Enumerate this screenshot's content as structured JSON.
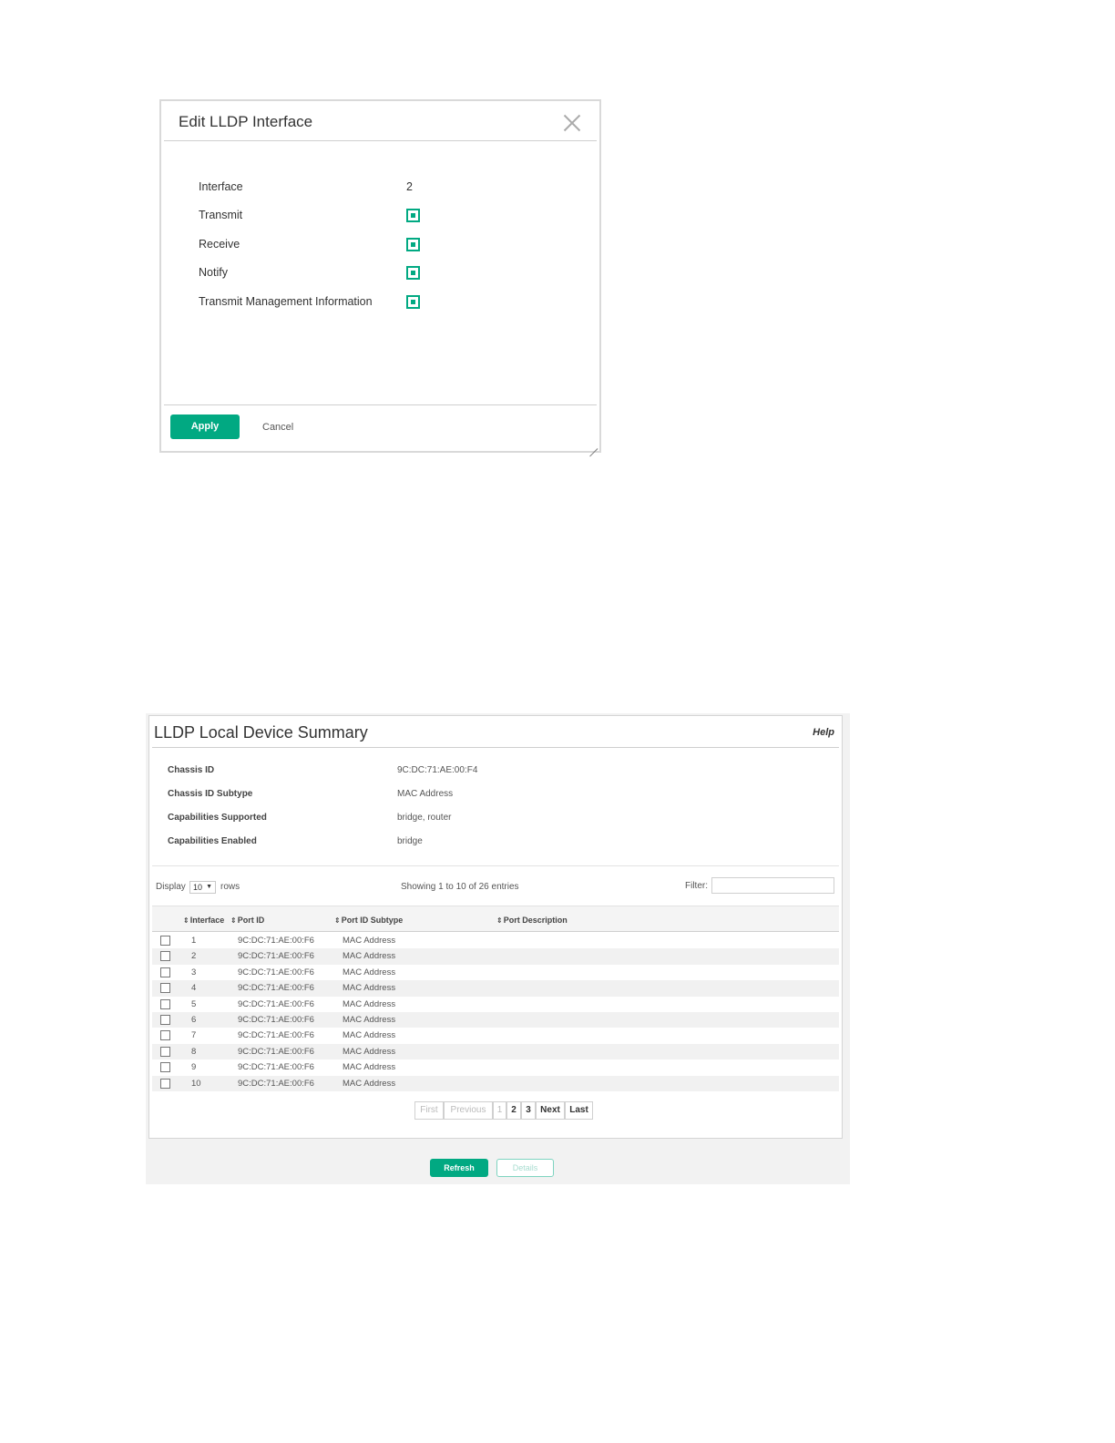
{
  "dialog": {
    "title": "Edit LLDP Interface",
    "fields": [
      {
        "label": "Interface",
        "value": "2"
      },
      {
        "label": "Transmit",
        "checked": true
      },
      {
        "label": "Receive",
        "checked": true
      },
      {
        "label": "Notify",
        "checked": true
      },
      {
        "label": "Transmit Management Information",
        "checked": true
      }
    ],
    "apply_label": "Apply",
    "cancel_label": "Cancel"
  },
  "summary": {
    "title": "LLDP Local Device Summary",
    "help_label": "Help",
    "info": [
      {
        "label": "Chassis ID",
        "value": "9C:DC:71:AE:00:F4"
      },
      {
        "label": "Chassis ID Subtype",
        "value": "MAC Address"
      },
      {
        "label": "Capabilities Supported",
        "value": "bridge, router"
      },
      {
        "label": "Capabilities Enabled",
        "value": "bridge"
      }
    ],
    "display_label": "Display",
    "display_value": "10",
    "rows_label": "rows",
    "showing_text": "Showing 1 to 10 of 26 entries",
    "filter_label": "Filter:",
    "filter_value": "",
    "columns": [
      "Interface",
      "Port ID",
      "Port ID Subtype",
      "Port Description"
    ],
    "rows": [
      {
        "interface": "1",
        "port_id": "9C:DC:71:AE:00:F6",
        "subtype": "MAC Address",
        "description": ""
      },
      {
        "interface": "2",
        "port_id": "9C:DC:71:AE:00:F6",
        "subtype": "MAC Address",
        "description": ""
      },
      {
        "interface": "3",
        "port_id": "9C:DC:71:AE:00:F6",
        "subtype": "MAC Address",
        "description": ""
      },
      {
        "interface": "4",
        "port_id": "9C:DC:71:AE:00:F6",
        "subtype": "MAC Address",
        "description": ""
      },
      {
        "interface": "5",
        "port_id": "9C:DC:71:AE:00:F6",
        "subtype": "MAC Address",
        "description": ""
      },
      {
        "interface": "6",
        "port_id": "9C:DC:71:AE:00:F6",
        "subtype": "MAC Address",
        "description": ""
      },
      {
        "interface": "7",
        "port_id": "9C:DC:71:AE:00:F6",
        "subtype": "MAC Address",
        "description": ""
      },
      {
        "interface": "8",
        "port_id": "9C:DC:71:AE:00:F6",
        "subtype": "MAC Address",
        "description": ""
      },
      {
        "interface": "9",
        "port_id": "9C:DC:71:AE:00:F6",
        "subtype": "MAC Address",
        "description": ""
      },
      {
        "interface": "10",
        "port_id": "9C:DC:71:AE:00:F6",
        "subtype": "MAC Address",
        "description": ""
      }
    ],
    "pagination": {
      "first": "First",
      "previous": "Previous",
      "pages": [
        "1",
        "2",
        "3"
      ],
      "next": "Next",
      "last": "Last"
    },
    "refresh_label": "Refresh",
    "details_label": "Details"
  },
  "colors": {
    "accent": "#01a982"
  },
  "icons": {
    "close": "close-icon",
    "sort": "sort-icon",
    "resize": "resize-grip-icon",
    "caret": "caret-down-icon"
  }
}
